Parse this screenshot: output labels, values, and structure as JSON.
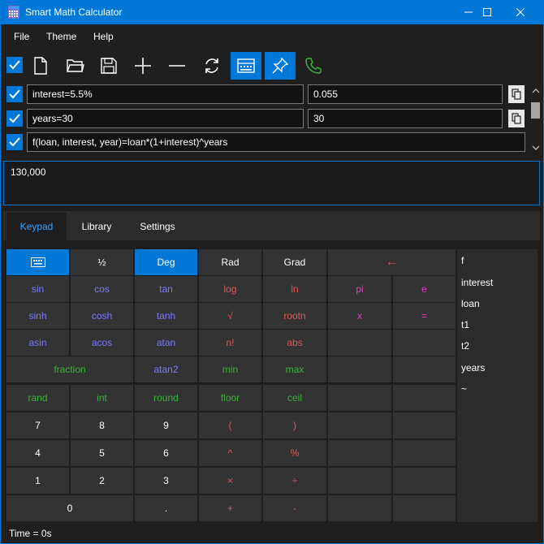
{
  "window": {
    "title": "Smart Math Calculator",
    "accent": "#0078d7"
  },
  "menu": [
    "File",
    "Theme",
    "Help"
  ],
  "toolbar": [
    {
      "name": "select-all-checkbox",
      "icon": "check-icon"
    },
    {
      "name": "new-button",
      "icon": "new-file-icon"
    },
    {
      "name": "open-button",
      "icon": "folder-icon"
    },
    {
      "name": "save-button",
      "icon": "save-icon"
    },
    {
      "name": "add-button",
      "icon": "plus-icon"
    },
    {
      "name": "remove-button",
      "icon": "minus-icon"
    },
    {
      "name": "refresh-button",
      "icon": "refresh-icon"
    },
    {
      "name": "keypad-toggle-button",
      "icon": "keypad-icon"
    },
    {
      "name": "pin-button",
      "icon": "pin-icon"
    },
    {
      "name": "call-button",
      "icon": "phone-icon"
    }
  ],
  "expressions": [
    {
      "expression": "interest=5.5%",
      "value": "0.055",
      "checked": true
    },
    {
      "expression": "years=30",
      "value": "30",
      "checked": true
    },
    {
      "expression": "f(loan, interest, year)=loan*(1+interest)^years",
      "checked": true
    }
  ],
  "result": "130,000",
  "tabs": [
    "Keypad",
    "Library",
    "Settings"
  ],
  "keypad": {
    "row1": [
      "",
      "½",
      "Deg",
      "Rad",
      "Grad",
      "←"
    ],
    "row2": [
      "sin",
      "cos",
      "tan",
      "log",
      "ln",
      "pi",
      "e"
    ],
    "row3": [
      "sinh",
      "cosh",
      "tanh",
      "√",
      "rootn",
      "x",
      "="
    ],
    "row4": [
      "asin",
      "acos",
      "atan",
      "n!",
      "abs"
    ],
    "row5": [
      "fraction",
      "atan2",
      "min",
      "max"
    ],
    "row6": [
      "rand",
      "int",
      "round",
      "floor",
      "ceil"
    ],
    "row7": [
      "7",
      "8",
      "9",
      "(",
      ")"
    ],
    "row8": [
      "4",
      "5",
      "6",
      "^",
      "%"
    ],
    "row9": [
      "1",
      "2",
      "3",
      "×",
      "÷"
    ],
    "row10": [
      "0",
      ".",
      "+",
      "-"
    ]
  },
  "variables": [
    "f",
    "interest",
    "loan",
    "t1",
    "t2",
    "years",
    "~"
  ],
  "status": "Time = 0s"
}
